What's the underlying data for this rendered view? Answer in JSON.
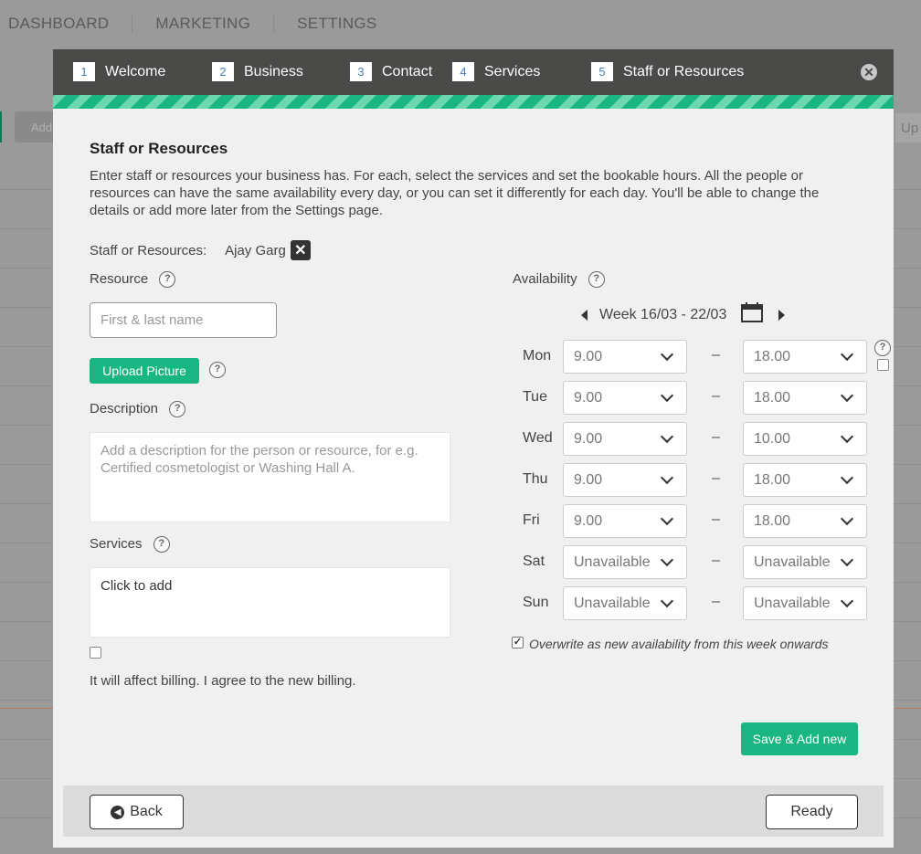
{
  "background": {
    "nav": [
      "DASHBOARD",
      "MARKETING",
      "SETTINGS"
    ],
    "add_label": "Add",
    "right_label": "Up"
  },
  "wizard": {
    "steps": [
      {
        "num": "1",
        "label": "Welcome"
      },
      {
        "num": "2",
        "label": "Business"
      },
      {
        "num": "3",
        "label": "Contact"
      },
      {
        "num": "4",
        "label": "Services"
      },
      {
        "num": "5",
        "label": "Staff or Resources"
      }
    ],
    "close_icon": "close-icon"
  },
  "page": {
    "title": "Staff or Resources",
    "intro": "Enter staff or resources your business has. For each, select the services and set the bookable hours. All the people or resources can have the same availability every day, or you can set it differently for each day. You'll be able to change the details or add more later from the Settings page."
  },
  "staff": {
    "label": "Staff or Resources:",
    "current": "Ajay Garg"
  },
  "resource": {
    "label": "Resource",
    "placeholder": "First & last name",
    "upload_label": "Upload Picture"
  },
  "description": {
    "label": "Description",
    "placeholder": "Add a description for the person or resource, for e.g. Certified cosmetologist or Washing Hall A."
  },
  "services": {
    "label": "Services",
    "placeholder": "Click to add"
  },
  "billing": {
    "text": "It will affect billing. I agree to the new billing.",
    "checked": false
  },
  "availability": {
    "label": "Availability",
    "week": "Week 16/03 - 22/03",
    "dash": "–",
    "days": [
      {
        "day": "Mon",
        "from": "9.00",
        "to": "18.00"
      },
      {
        "day": "Tue",
        "from": "9.00",
        "to": "18.00"
      },
      {
        "day": "Wed",
        "from": "9.00",
        "to": "10.00"
      },
      {
        "day": "Thu",
        "from": "9.00",
        "to": "18.00"
      },
      {
        "day": "Fri",
        "from": "9.00",
        "to": "18.00"
      },
      {
        "day": "Sat",
        "from": "Unavailable",
        "to": "Unavailable"
      },
      {
        "day": "Sun",
        "from": "Unavailable",
        "to": "Unavailable"
      }
    ],
    "overwrite_text": "Overwrite as new availability from this week onwards",
    "overwrite_checked": true,
    "save_label": "Save & Add new"
  },
  "footer": {
    "back_label": "Back",
    "ready_label": "Ready"
  },
  "colors": {
    "accent": "#19b683",
    "header": "#4a4a49"
  }
}
